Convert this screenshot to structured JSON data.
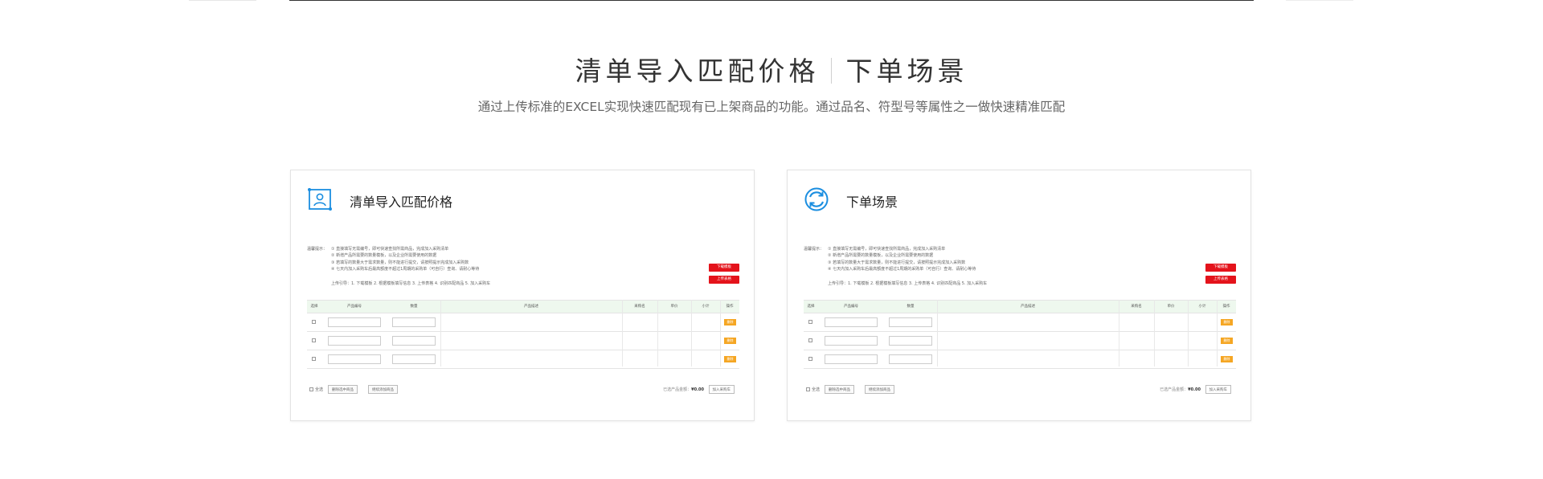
{
  "heading": {
    "left": "清单导入匹配价格",
    "right": "下单场景"
  },
  "subtitle": "通过上传标准的EXCEL实现快速匹配现有已上架商品的功能。通过品名、符型号等属性之一做快速精准匹配",
  "colors": {
    "accent_blue": "#1b8ee0",
    "red": "#e4131b",
    "orange": "#f5a623",
    "table_header_bg": "#eef8ee"
  },
  "cards": [
    {
      "title": "清单导入匹配价格",
      "icon": "image-user-icon"
    },
    {
      "title": "下单场景",
      "icon": "cycle-arrows-icon"
    }
  ],
  "mock": {
    "tips_label": "温馨提示：",
    "tips": [
      "① 直接填写无需编号，即可快速查找所需商品，完成加入采购清单",
      "② 新增产品所需要的数量模板，以及企业所需要使用的数据",
      "③ 若填写的数量大于需求数量，则不能进行提交，请按照提示完成加入采购数",
      "④ 七天内加入采购车后最高额度不超过1周期的采购单（可自行）查询、请耐心等待"
    ],
    "steps": "上传引导：1. 下载模板 2. 根据模板填写信息 3. 上传表格 4. 识别匹配商品 5. 加入采购车",
    "btn_download": "下载模板",
    "btn_upload": "上传表格",
    "columns": [
      "选择",
      "产品编号",
      "数量",
      "产品描述",
      "采购名",
      "单价",
      "小计",
      "操作"
    ],
    "row_action": "删除",
    "select_all": "全选",
    "btn_delete_selected": "删除选中商品",
    "btn_clear": "继续添加商品",
    "total_label": "已选产品金额：",
    "total_value": "¥0.00",
    "btn_add_cart": "加入采购车"
  }
}
